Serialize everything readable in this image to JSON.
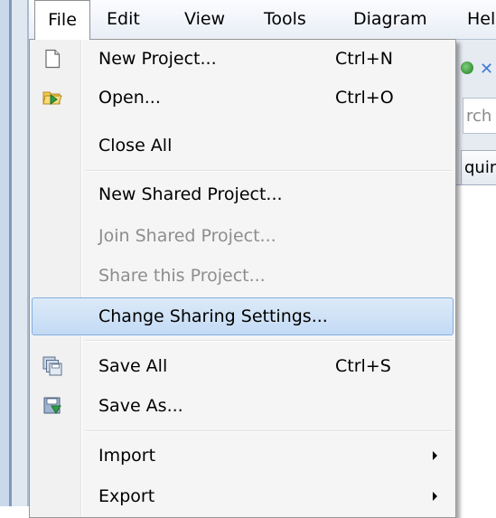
{
  "menubar": {
    "items": [
      {
        "label": "File",
        "active": true
      },
      {
        "label": "Edit"
      },
      {
        "label": "View"
      },
      {
        "label": "Tools"
      },
      {
        "label": "Diagram"
      },
      {
        "label": "Hel"
      }
    ]
  },
  "background": {
    "search_placeholder": "rch N",
    "tab_label": "quire"
  },
  "file_menu": {
    "items": [
      {
        "label": "New Project...",
        "shortcut": "Ctrl+N",
        "icon": "new-document-icon"
      },
      {
        "label": "Open...",
        "shortcut": "Ctrl+O",
        "icon": "open-folder-icon"
      },
      {
        "label": "Close All"
      },
      {
        "label": "New Shared Project..."
      },
      {
        "label": "Join Shared Project...",
        "disabled": true
      },
      {
        "label": "Share this Project...",
        "disabled": true
      },
      {
        "label": "Change Sharing Settings...",
        "highlighted": true
      },
      {
        "label": "Save All",
        "shortcut": "Ctrl+S",
        "icon": "save-all-icon"
      },
      {
        "label": "Save As...",
        "icon": "save-as-icon"
      },
      {
        "label": "Import",
        "submenu": true
      },
      {
        "label": "Export",
        "submenu": true
      }
    ]
  },
  "colors": {
    "highlight": "#c3daf5",
    "highlight_border": "#85aee0",
    "disabled_text": "#8d8d8d",
    "menubar_bg": "#e9eef6"
  }
}
